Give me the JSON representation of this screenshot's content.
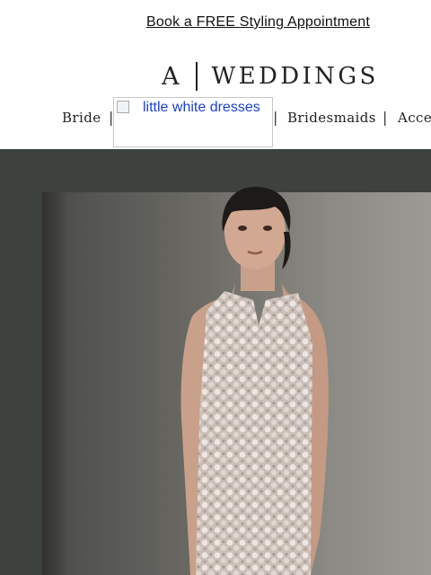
{
  "promo": {
    "link_text": "Book a FREE Styling Appointment"
  },
  "brand": {
    "monogram": "A",
    "wordmark": "WEDDINGS"
  },
  "nav": {
    "items": [
      {
        "label": "Bride"
      },
      {
        "label": "Bridesmaids"
      },
      {
        "label": "Acces"
      }
    ],
    "separator": "|",
    "broken_image_alt": "little white dresses"
  },
  "hero": {
    "description_visible": false,
    "colors": {
      "wall": "#3e423f",
      "backdrop": "#8c8a84",
      "dress": "#d9cfc9",
      "hair": "#1c1a19",
      "skin": "#cfa58f"
    }
  }
}
